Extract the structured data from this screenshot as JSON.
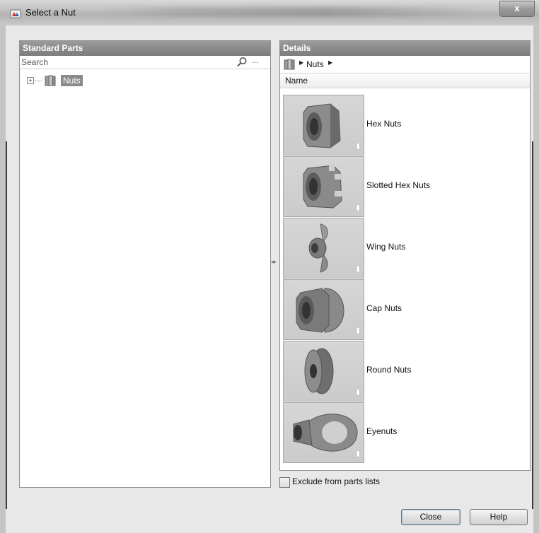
{
  "window": {
    "title": "Select a Nut",
    "close_glyph": "x"
  },
  "left_pane": {
    "header": "Standard Parts",
    "search": {
      "placeholder": "Search",
      "value": "",
      "more": "..."
    },
    "tree": [
      {
        "label": "Nuts",
        "expander": "+",
        "icon": "parts-folder-icon",
        "selected": true
      }
    ]
  },
  "right_pane": {
    "header": "Details",
    "breadcrumb": {
      "icon": "parts-folder-icon",
      "items": [
        "Nuts"
      ]
    },
    "column_header": "Name",
    "items": [
      {
        "label": "Hex Nuts",
        "icon": "hex-nut-icon"
      },
      {
        "label": "Slotted Hex Nuts",
        "icon": "slotted-hex-nut-icon"
      },
      {
        "label": "Wing Nuts",
        "icon": "wing-nut-icon"
      },
      {
        "label": "Cap Nuts",
        "icon": "cap-nut-icon"
      },
      {
        "label": "Round Nuts",
        "icon": "round-nut-icon"
      },
      {
        "label": "Eyenuts",
        "icon": "eye-nut-icon"
      }
    ]
  },
  "exclude_checkbox": {
    "label": "Exclude from parts lists",
    "checked": false
  },
  "buttons": {
    "close": "Close",
    "help": "Help"
  }
}
